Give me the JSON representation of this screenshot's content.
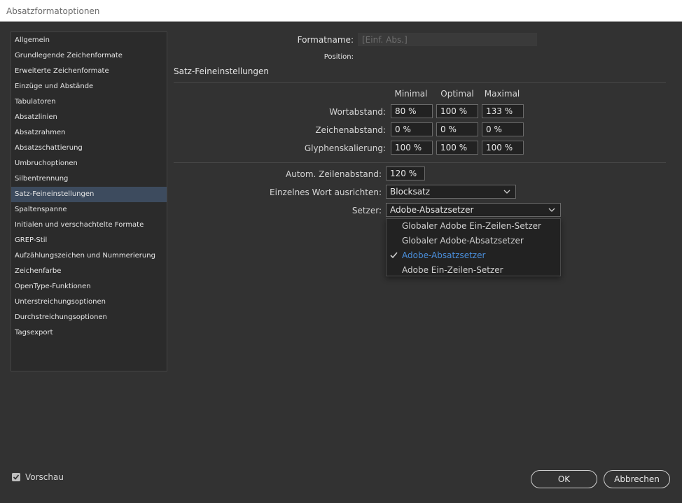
{
  "window": {
    "title": "Absatzformatoptionen"
  },
  "sidebar": {
    "items": [
      {
        "label": "Allgemein"
      },
      {
        "label": "Grundlegende Zeichenformate"
      },
      {
        "label": "Erweiterte Zeichenformate"
      },
      {
        "label": "Einzüge und Abstände"
      },
      {
        "label": "Tabulatoren"
      },
      {
        "label": "Absatzlinien"
      },
      {
        "label": "Absatzrahmen"
      },
      {
        "label": "Absatzschattierung"
      },
      {
        "label": "Umbruchoptionen"
      },
      {
        "label": "Silbentrennung"
      },
      {
        "label": "Satz-Feineinstellungen",
        "selected": true
      },
      {
        "label": "Spaltenspanne"
      },
      {
        "label": "Initialen und verschachtelte Formate"
      },
      {
        "label": "GREP-Stil"
      },
      {
        "label": "Aufzählungszeichen und Nummerierung"
      },
      {
        "label": "Zeichenfarbe"
      },
      {
        "label": "OpenType-Funktionen"
      },
      {
        "label": "Unterstreichungsoptionen"
      },
      {
        "label": "Durchstreichungsoptionen"
      },
      {
        "label": "Tagsexport"
      }
    ]
  },
  "header": {
    "formatname_label": "Formatname:",
    "formatname_value": "[Einf. Abs.]",
    "position_label": "Position:"
  },
  "section": {
    "title": "Satz-Feineinstellungen"
  },
  "grid": {
    "col_minimal": "Minimal",
    "col_optimal": "Optimal",
    "col_maximal": "Maximal",
    "rows": [
      {
        "label": "Wortabstand:",
        "min": "80 %",
        "opt": "100 %",
        "max": "133 %"
      },
      {
        "label": "Zeichenabstand:",
        "min": "0 %",
        "opt": "0 %",
        "max": "0 %"
      },
      {
        "label": "Glyphenskalierung:",
        "min": "100 %",
        "opt": "100 %",
        "max": "100 %"
      }
    ]
  },
  "lower": {
    "leading_label": "Autom. Zeilenabstand:",
    "leading_value": "120 %",
    "single_word_label": "Einzelnes Wort ausrichten:",
    "single_word_value": "Blocksatz",
    "composer_label": "Setzer:",
    "composer_value": "Adobe-Absatzsetzer"
  },
  "composer_menu": {
    "options": [
      {
        "label": "Globaler Adobe Ein-Zeilen-Setzer"
      },
      {
        "label": "Globaler Adobe-Absatzsetzer"
      },
      {
        "label": "Adobe-Absatzsetzer",
        "checked": true
      },
      {
        "label": "Adobe Ein-Zeilen-Setzer"
      }
    ]
  },
  "footer": {
    "preview_label": "Vorschau",
    "preview_checked": true,
    "ok_label": "OK",
    "cancel_label": "Abbrechen"
  },
  "colors": {
    "background": "#323232",
    "selection": "#3d4b5e",
    "accent": "#4a8fdc"
  }
}
